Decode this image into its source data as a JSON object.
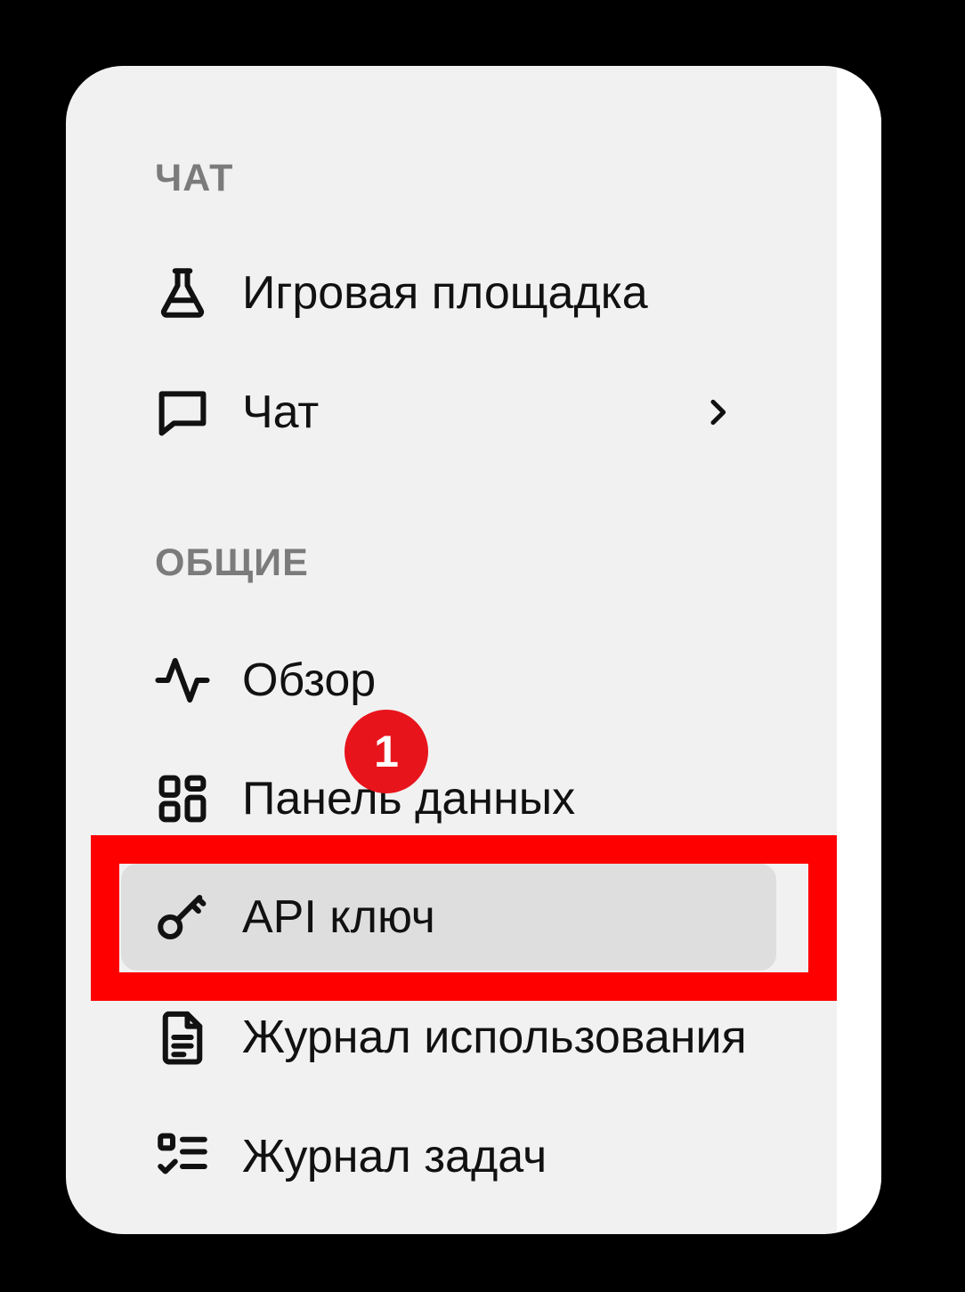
{
  "sidebar": {
    "sections": [
      {
        "title": "ЧАТ",
        "items": [
          {
            "label": "Игровая площадка",
            "icon": "flask-icon"
          },
          {
            "label": "Чат",
            "icon": "chat-bubble-icon",
            "has_submenu": true
          }
        ]
      },
      {
        "title": "ОБЩИЕ",
        "items": [
          {
            "label": "Обзор",
            "icon": "activity-icon"
          },
          {
            "label": "Панель данных",
            "icon": "dashboard-grid-icon"
          },
          {
            "label": "API ключ",
            "icon": "key-icon",
            "selected": true
          },
          {
            "label": "Журнал использования",
            "icon": "document-icon"
          },
          {
            "label": "Журнал задач",
            "icon": "task-list-icon"
          }
        ]
      }
    ]
  },
  "annotation": {
    "step_number": "1",
    "highlight_color": "#ff0000",
    "badge_color": "#e8141c"
  }
}
